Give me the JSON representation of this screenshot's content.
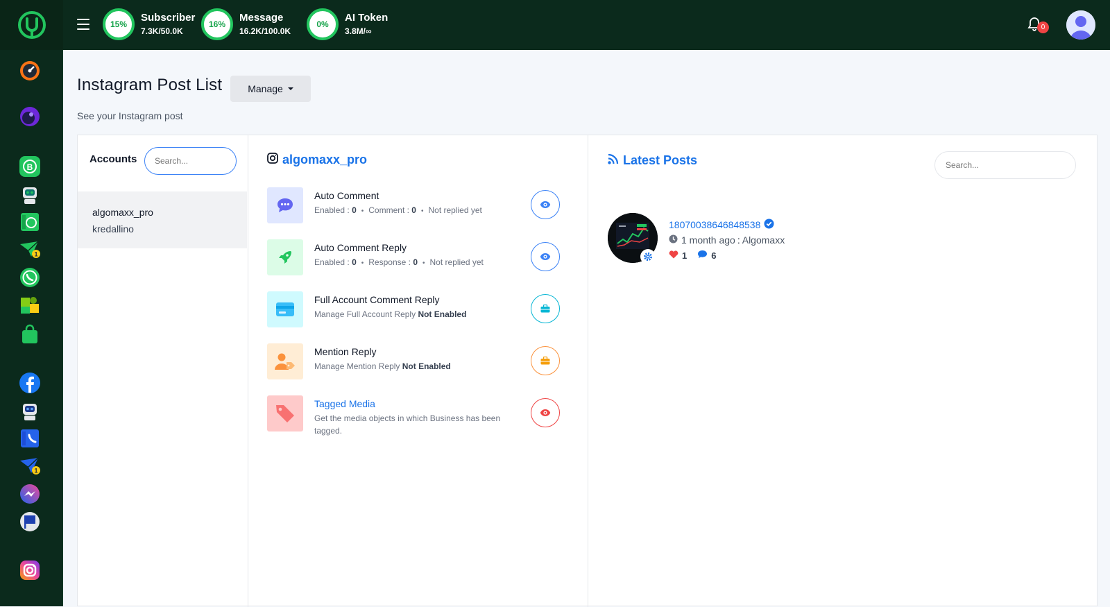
{
  "app": {
    "brand_color": "#0b2a1c",
    "accent": "#22c55e",
    "link_color": "#1a73e8"
  },
  "sidebar": {
    "icons": [
      "logo-icon",
      "dashboard-gauge-icon",
      "ai-orb-icon",
      "whatsapp-business-icon",
      "chatbot-icon",
      "ecommerce-whatsapp-icon",
      "broadcast-icon",
      "whatsapp-icon",
      "puzzle-icon",
      "shopping-bag-icon",
      "facebook-icon",
      "bot-icon",
      "contacts-icon",
      "campaign-icon",
      "messenger-icon",
      "flag-icon",
      "instagram-icon"
    ]
  },
  "topbar": {
    "stats": [
      {
        "percent": "15%",
        "label": "Subscriber",
        "value": "7.3K/50.0K"
      },
      {
        "percent": "16%",
        "label": "Message",
        "value": "16.2K/100.0K"
      },
      {
        "percent": "0%",
        "label": "AI Token",
        "value": "3.8M/∞"
      }
    ],
    "notification_count": "0"
  },
  "header": {
    "title": "Instagram Post List",
    "manage_label": "Manage",
    "subtitle": "See your Instagram post"
  },
  "accounts": {
    "label": "Accounts",
    "search_placeholder": "Search...",
    "items": [
      {
        "name": "algomaxx_pro",
        "username": "kredallino"
      }
    ]
  },
  "account_panel": {
    "handle": "algomaxx_pro",
    "features": [
      {
        "title": "Auto Comment",
        "enabled_label": "Enabled :",
        "enabled_value": "0",
        "count_label": "Comment :",
        "count_value": "0",
        "status": "Not replied yet"
      },
      {
        "title": "Auto Comment Reply",
        "enabled_label": "Enabled :",
        "enabled_value": "0",
        "count_label": "Response :",
        "count_value": "0",
        "status": "Not replied yet"
      },
      {
        "title": "Full Account Comment Reply",
        "desc": "Manage Full Account Reply",
        "state": "Not Enabled"
      },
      {
        "title": "Mention Reply",
        "desc": "Manage Mention Reply",
        "state": "Not Enabled"
      },
      {
        "title": "Tagged Media",
        "desc": "Get the media objects in which Business has been tagged."
      }
    ]
  },
  "latest_posts": {
    "title": "Latest Posts",
    "search_placeholder": "Search...",
    "posts": [
      {
        "id": "18070038646848538",
        "time": "1 month ago",
        "author": "Algomaxx",
        "likes": "1",
        "comments": "6"
      }
    ]
  }
}
